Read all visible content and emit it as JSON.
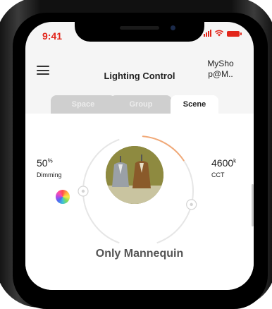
{
  "status_bar": {
    "time": "9:41",
    "accent_color": "#e2261b"
  },
  "header": {
    "title": "Lighting Control",
    "account_line1": "MySho",
    "account_line2": "p@M..",
    "menu_icon": "hamburger-menu-icon"
  },
  "tabs": [
    {
      "label": "Space",
      "active": false
    },
    {
      "label": "Group",
      "active": false
    },
    {
      "label": "Scene",
      "active": true
    }
  ],
  "dimming": {
    "value": "50",
    "unit": "%",
    "label": "Dimming"
  },
  "cct": {
    "value": "4600",
    "unit": "k",
    "label": "CCT"
  },
  "dial": {
    "dimming_level": 0.5,
    "cct_level": 0.6,
    "track_color": "#e6e6e6",
    "cct_color": "#f1a978",
    "handle_icon": "slider-handle-icon"
  },
  "scene": {
    "name": "Only Mannequin"
  },
  "icons": {
    "color_picker": "color-wheel-icon",
    "scene_image": "mannequin-photo"
  }
}
